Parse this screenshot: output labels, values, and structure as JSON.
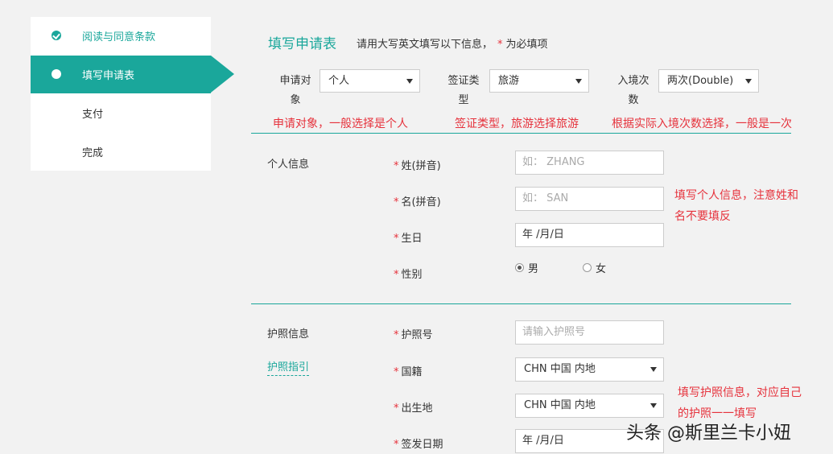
{
  "sidebar": {
    "steps": [
      {
        "label": "阅读与同意条款",
        "state": "done"
      },
      {
        "label": "填写申请表",
        "state": "active"
      },
      {
        "label": "支付",
        "state": "pending"
      },
      {
        "label": "完成",
        "state": "pending"
      }
    ]
  },
  "header": {
    "title": "填写申请表",
    "hint_prefix": "请用大写英文填写以下信息，",
    "required_mark": "*",
    "hint_suffix": "为必填项"
  },
  "top_selects": {
    "applicant": {
      "label_line1": "申请对",
      "label_line2": "象",
      "value": "个人",
      "annotation": "申请对象，一般选择是个人"
    },
    "visa_type": {
      "label_line1": "签证类",
      "label_line2": "型",
      "value": "旅游",
      "annotation": "签证类型，旅游选择旅游"
    },
    "entries": {
      "label_line1": "入境次",
      "label_line2": "数",
      "value": "两次(Double)",
      "annotation": "根据实际入境次数选择，一般是一次"
    }
  },
  "personal": {
    "section_label": "个人信息",
    "surname_label": "姓(拼音)",
    "surname_placeholder": "如： ZHANG",
    "given_label": "名(拼音)",
    "given_placeholder": "如： SAN",
    "birth_label": "生日",
    "birth_value": "年 /月/日",
    "gender_label": "性别",
    "gender_male": "男",
    "gender_female": "女",
    "gender_selected": "男",
    "annotation_line1": "填写个人信息，注意姓和",
    "annotation_line2": "名不要填反"
  },
  "passport": {
    "section_label": "护照信息",
    "guide_link": "护照指引",
    "number_label": "护照号",
    "number_placeholder": "请输入护照号",
    "nationality_label": "国籍",
    "nationality_value": "CHN 中国 内地",
    "birthplace_label": "出生地",
    "birthplace_value": "CHN 中国 内地",
    "issue_date_label": "签发日期",
    "issue_date_value": "年 /月/日",
    "annotation_line1": "填写护照信息，对应自己",
    "annotation_line2": "的护照一一填写"
  },
  "watermark": "头条 @斯里兰卡小妞",
  "colors": {
    "accent": "#1aa79b",
    "required": "#e6323c",
    "annotation": "#e6323c"
  }
}
